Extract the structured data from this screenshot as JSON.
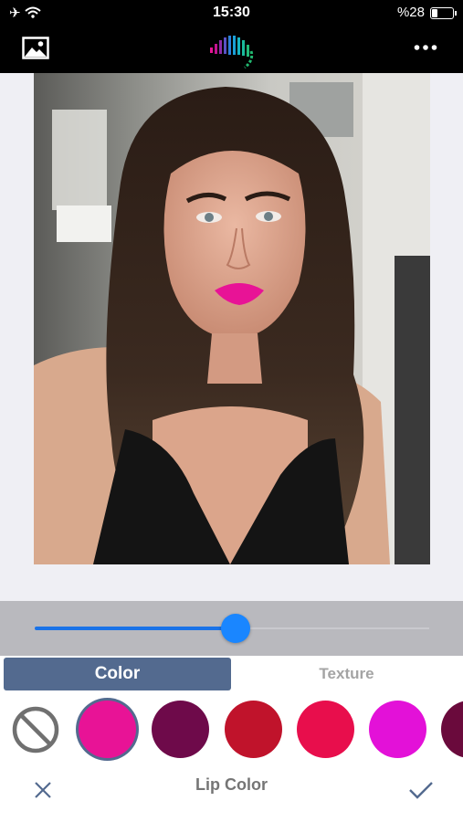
{
  "status_bar": {
    "time": "15:30",
    "battery_text": "%28",
    "battery_level": 0.28,
    "signal": "airplane, wifi"
  },
  "top_bar": {
    "left_icon": "gallery-icon",
    "center_icon": "app-logo",
    "right_icon": "more-icon"
  },
  "adjuster": {
    "value": 0.51,
    "accent": "#1a86ff"
  },
  "tabs": [
    {
      "label": "Color",
      "active": true
    },
    {
      "label": "Texture",
      "active": false
    }
  ],
  "swatches": {
    "none_icon": "no-color-icon",
    "colors": [
      "#e81396",
      "#6e0a4a",
      "#c0132b",
      "#e80e4c",
      "#e311d8",
      "#6a0a3c"
    ],
    "selected": 0
  },
  "bottom_bar": {
    "title": "Lip Color",
    "cancel_icon": "close-icon",
    "confirm_icon": "checkmark-icon"
  }
}
